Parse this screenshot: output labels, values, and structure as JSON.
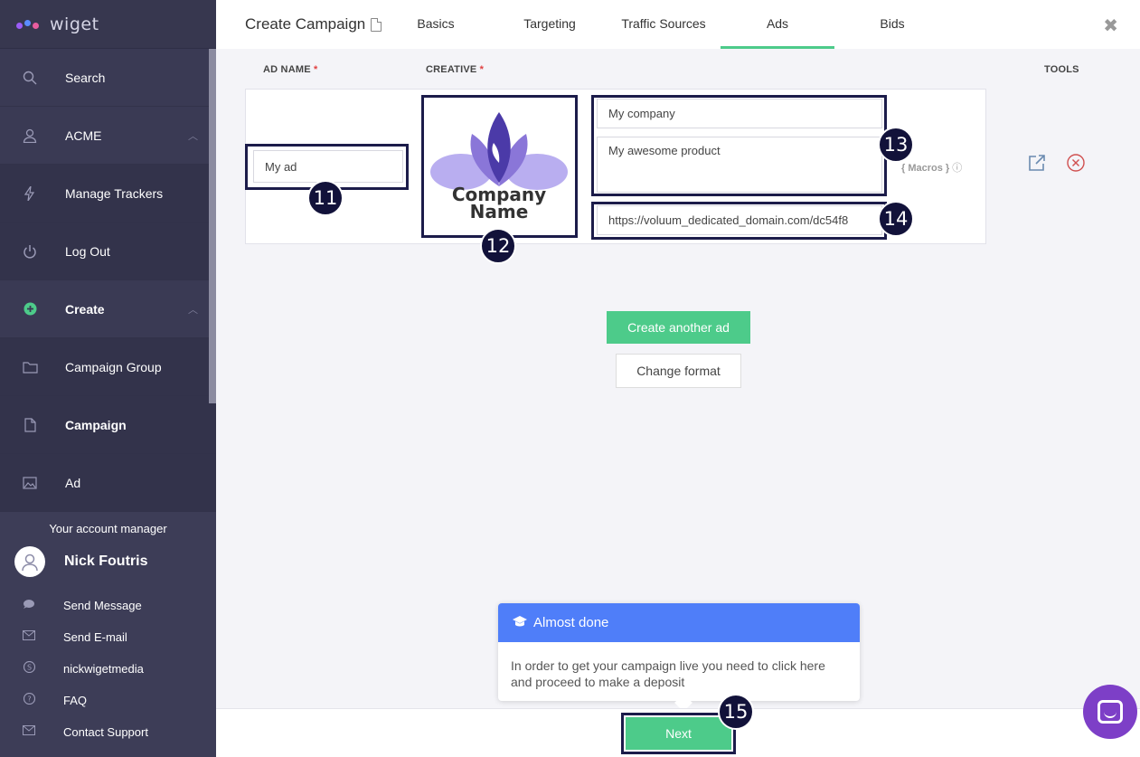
{
  "app": {
    "logo_text": "wiget",
    "logo_colors": [
      "#9b5cf6",
      "#5b8cff",
      "#e85d9f"
    ]
  },
  "sidebar": {
    "items": [
      {
        "label": "Search",
        "icon": "search-icon"
      },
      {
        "label": "ACME",
        "icon": "user-icon"
      },
      {
        "label": "Manage Trackers",
        "icon": "bolt-icon"
      },
      {
        "label": "Log Out",
        "icon": "power-icon"
      },
      {
        "label": "Create",
        "icon": "plus-circle-icon"
      },
      {
        "label": "Campaign Group",
        "icon": "folder-icon"
      },
      {
        "label": "Campaign",
        "icon": "file-icon"
      },
      {
        "label": "Ad",
        "icon": "image-icon"
      }
    ],
    "account": {
      "title": "Your account manager",
      "name": "Nick Foutris",
      "links": [
        {
          "label": "Send Message",
          "icon": "chat-bubble-icon"
        },
        {
          "label": "Send E-mail",
          "icon": "envelope-icon"
        },
        {
          "label": "nickwigetmedia",
          "icon": "skype-icon"
        },
        {
          "label": "FAQ",
          "icon": "question-icon"
        },
        {
          "label": "Contact Support",
          "icon": "envelope-icon"
        }
      ]
    }
  },
  "header": {
    "title": "Create Campaign",
    "tabs": [
      "Basics",
      "Targeting",
      "Traffic Sources",
      "Ads",
      "Bids"
    ],
    "active_tab": "Ads"
  },
  "table": {
    "col_ad_name": "AD NAME",
    "col_creative": "CREATIVE",
    "col_tools": "TOOLS",
    "required_mark": "*"
  },
  "ad": {
    "name": "My ad",
    "creative_line1": "Company",
    "creative_line2": "Name",
    "title": "My company",
    "description": "My awesome product",
    "url": "https://voluum_dedicated_domain.com/dc54f8",
    "macros": "{ Macros }"
  },
  "badges": {
    "b11": "11",
    "b12": "12",
    "b13": "13",
    "b14": "14",
    "b15": "15"
  },
  "buttons": {
    "create_another": "Create another ad",
    "change_format": "Change format",
    "next": "Next"
  },
  "tooltip": {
    "title": "Almost done",
    "body": "In order to get your campaign live you need to click here and proceed to make a deposit"
  },
  "colors": {
    "accent_green": "#4dcb8a",
    "sidebar_bg": "#3a3a54",
    "tooltip_blue": "#4f7ef9",
    "chat_purple": "#7d3fc7"
  }
}
